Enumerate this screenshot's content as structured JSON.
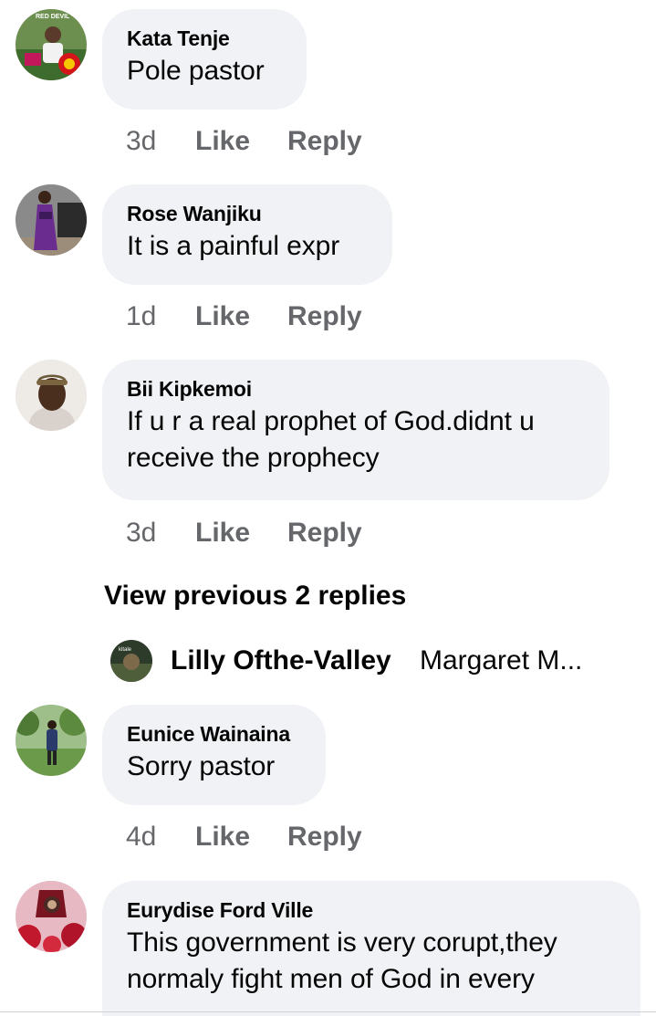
{
  "comments": [
    {
      "author": "Kata Tenje",
      "text": "Pole pastor",
      "time": "3d",
      "like_label": "Like",
      "reply_label": "Reply"
    },
    {
      "author": "Rose Wanjiku",
      "text": "It is a painful expr",
      "time": "1d",
      "like_label": "Like",
      "reply_label": "Reply"
    },
    {
      "author": "Bii Kipkemoi",
      "text": "If u r a real prophet of God.didnt u receive the prophecy",
      "time": "3d",
      "like_label": "Like",
      "reply_label": "Reply"
    },
    {
      "author": "Eunice Wainaina",
      "text": "Sorry pastor",
      "time": "4d",
      "like_label": "Like",
      "reply_label": "Reply"
    },
    {
      "author": "Eurydise Ford Ville",
      "text": "This government is very corupt,they normaly fight men of God in every"
    }
  ],
  "view_previous": "View previous 2 replies",
  "reply_preview": {
    "name": "Lilly Ofthe-Valley",
    "snippet": "Margaret M..."
  },
  "avatar_logo_text": {
    "kata_tenje": "RED DEVIL",
    "lilly": "kitale"
  },
  "colors": {
    "bubble": "#f0f2f5",
    "meta_gray": "#65676b",
    "text": "#050505"
  }
}
